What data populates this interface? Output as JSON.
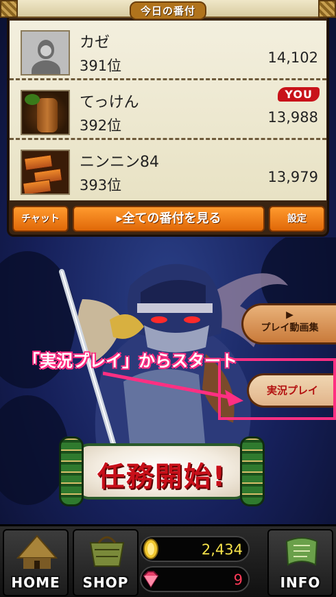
{
  "header": {
    "title": "今日の番付"
  },
  "leaderboard": [
    {
      "name": "カゼ",
      "rank": "391位",
      "score": "14,102",
      "avatar": "default-avatar-icon",
      "you": ""
    },
    {
      "name": "てっけん",
      "rank": "392位",
      "score": "13,988",
      "avatar": "wooden-doll-icon",
      "you": "YOU"
    },
    {
      "name": "ニンニン84",
      "rank": "393位",
      "score": "13,979",
      "avatar": "treasure-boxes-icon",
      "you": ""
    }
  ],
  "panel_buttons": {
    "chat": "チャット",
    "view_all": "▸全ての番付を見る",
    "settings": "設定"
  },
  "scene": {
    "video_button": "プレイ動画集",
    "video_play": "▶",
    "live_button": "実況プレイ",
    "annotation": "「実況プレイ」からスタート",
    "mission_button": "任務開始!"
  },
  "colors": {
    "highlight": "#ff2f82",
    "button_orange": "#f08418",
    "mission_red": "#c8101a"
  },
  "bottom_nav": {
    "home": "HOME",
    "shop": "SHOP",
    "info": "INFO",
    "gold": "2,434",
    "gems": "9"
  }
}
